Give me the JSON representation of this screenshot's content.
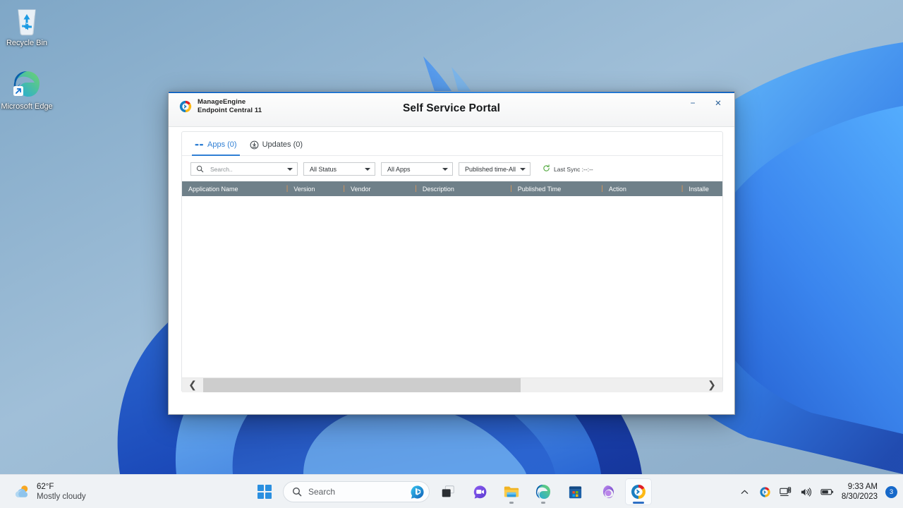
{
  "desktop": {
    "icons": [
      {
        "name": "recycle-bin",
        "label": "Recycle Bin"
      },
      {
        "name": "microsoft-edge",
        "label": "Microsoft Edge"
      }
    ]
  },
  "window": {
    "brand_line1": "ManageEngine",
    "brand_line2": "Endpoint Central 11",
    "title": "Self Service Portal",
    "minimize_label": "−",
    "close_label": "✕",
    "accent_color": "#2f7fd4"
  },
  "tabs": [
    {
      "label": "Apps (0)",
      "icon": "apps-icon",
      "active": true
    },
    {
      "label": "Updates (0)",
      "icon": "updates-download-icon",
      "active": false
    }
  ],
  "filters": {
    "search_placeholder": "Search..",
    "search_value": "",
    "status_selected": "All Status",
    "apps_selected": "All Apps",
    "published_time_selected": "Published time-All",
    "last_sync_label": "Last Sync :--:--",
    "sync_icon": "refresh-icon",
    "header_color": "#6f8089"
  },
  "table": {
    "columns": [
      "Application Name",
      "Version",
      "Vendor",
      "Description",
      "Published Time",
      "Action",
      "Installe"
    ],
    "rows": []
  },
  "scrollbar": {
    "left_arrow": "❮",
    "right_arrow": "❯"
  },
  "taskbar": {
    "weather_temp": "62°F",
    "weather_desc": "Mostly cloudy",
    "weather_icon": "sun-cloud-icon",
    "start_label": "Start",
    "search_placeholder": "Search",
    "search_icon": "search-icon",
    "bing_chat_icon": "bing-chat-icon",
    "apps": [
      {
        "name": "task-view",
        "icon": "task-view-icon",
        "running": false,
        "active": false
      },
      {
        "name": "chat",
        "icon": "chat-icon",
        "running": false,
        "active": false
      },
      {
        "name": "file-explorer",
        "icon": "folder-icon",
        "running": true,
        "active": false
      },
      {
        "name": "microsoft-edge",
        "icon": "edge-icon",
        "running": true,
        "active": false
      },
      {
        "name": "microsoft-store",
        "icon": "store-icon",
        "running": false,
        "active": false
      },
      {
        "name": "microsoft-365",
        "icon": "office-icon",
        "running": false,
        "active": false
      },
      {
        "name": "manageengine-endpoint-central",
        "icon": "manageengine-icon",
        "running": true,
        "active": true
      }
    ],
    "tray": {
      "overflow_icon": "chevron-up-icon",
      "manageengine_tray_icon": "manageengine-tray-icon",
      "network_icon": "network-icon",
      "volume_icon": "volume-icon",
      "battery_icon": "battery-icon",
      "time": "9:33 AM",
      "date": "8/30/2023",
      "notification_count": "3"
    }
  }
}
